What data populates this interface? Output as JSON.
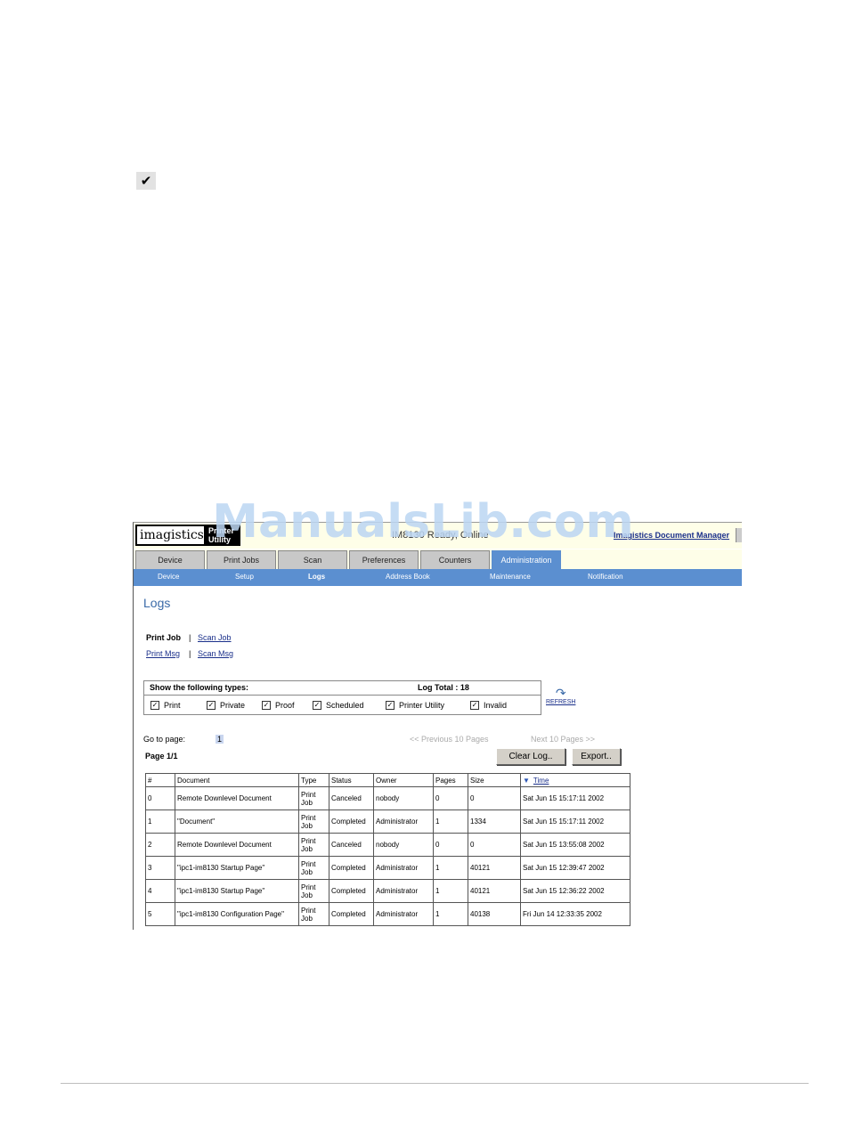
{
  "watermark": "ManualsLib.com",
  "check_glyph": "✔",
  "app": {
    "logo_brand": "imagistics",
    "logo_product_line1": "Printer",
    "logo_product_line2": "Utility",
    "status": "IM8130 Ready, Online",
    "link": "Imagistics Document Manager"
  },
  "tabs": [
    "Device",
    "Print Jobs",
    "Scan",
    "Preferences",
    "Counters",
    "Administration"
  ],
  "subnav": [
    "Device",
    "Setup",
    "Logs",
    "Address Book",
    "Maintenance",
    "Notification"
  ],
  "page_title": "Logs",
  "log_links": {
    "print_job": "Print Job",
    "scan_job": "Scan Job",
    "print_msg": "Print Msg",
    "scan_msg": "Scan Msg",
    "sep": "|"
  },
  "filter": {
    "heading": "Show the following types:",
    "total": "Log Total : 18",
    "types": [
      "Print",
      "Private",
      "Proof",
      "Scheduled",
      "Printer Utility",
      "Invalid"
    ],
    "check": "✓"
  },
  "refresh": {
    "icon": "↷",
    "label": "REFRESH"
  },
  "pager": {
    "go_to": "Go to page:",
    "current": "1",
    "prev": "<< Previous 10 Pages",
    "next": "Next 10 Pages >>",
    "page_info": "Page 1/1"
  },
  "buttons": {
    "clear": "Clear Log..",
    "export": "Export.."
  },
  "table": {
    "headers": [
      "#",
      "Document",
      "Type",
      "Status",
      "Owner",
      "Pages",
      "Size",
      "Time"
    ],
    "sort_icon": "▼",
    "rows": [
      [
        "0",
        "Remote Downlevel Document",
        "Print Job",
        "Canceled",
        "nobody",
        "0",
        "0",
        "Sat Jun 15 15:17:11 2002"
      ],
      [
        "1",
        "\"Document\"",
        "Print Job",
        "Completed",
        "Administrator",
        "1",
        "1334",
        "Sat Jun 15 15:17:11 2002"
      ],
      [
        "2",
        "Remote Downlevel Document",
        "Print Job",
        "Canceled",
        "nobody",
        "0",
        "0",
        "Sat Jun 15 13:55:08 2002"
      ],
      [
        "3",
        "\"ipc1-im8130 Startup Page\"",
        "Print Job",
        "Completed",
        "Administrator",
        "1",
        "40121",
        "Sat Jun 15 12:39:47 2002"
      ],
      [
        "4",
        "\"ipc1-im8130 Startup Page\"",
        "Print Job",
        "Completed",
        "Administrator",
        "1",
        "40121",
        "Sat Jun 15 12:36:22 2002"
      ],
      [
        "5",
        "\"ipc1-im8130 Configuration Page\"",
        "Print Job",
        "Completed",
        "Administrator",
        "1",
        "40138",
        "Fri Jun 14 12:33:35 2002"
      ]
    ]
  }
}
